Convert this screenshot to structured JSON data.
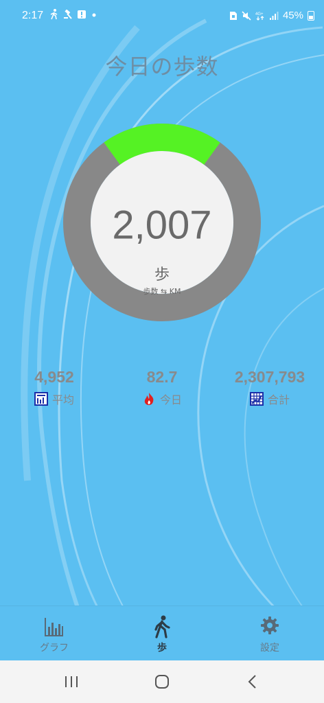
{
  "status": {
    "time": "2:17",
    "battery": "45%",
    "left_icons": [
      "walking-icon",
      "gavel-icon",
      "alert-icon",
      "dot-icon"
    ],
    "right_icons": [
      "sim-icon",
      "mute-icon",
      "data-4g-icon",
      "signal-icon",
      "battery-icon"
    ],
    "network_label": "4G+"
  },
  "page": {
    "title": "今日の歩数"
  },
  "gauge": {
    "value": "2,007",
    "unit": "歩",
    "toggle_label": "歩数 ⇆ KM",
    "progress_fraction": 0.2,
    "progress_color": "#55f224",
    "track_color": "#888888"
  },
  "stats": [
    {
      "value": "4,952",
      "label": "平均",
      "icon": "average-chart-icon"
    },
    {
      "value": "82.7",
      "label": "今日",
      "icon": "flame-icon"
    },
    {
      "value": "2,307,793",
      "label": "合計",
      "icon": "total-grid-icon"
    }
  ],
  "nav": [
    {
      "label": "グラフ",
      "icon": "bar-chart-icon",
      "active": false
    },
    {
      "label": "歩",
      "icon": "walking-icon",
      "active": true
    },
    {
      "label": "設定",
      "icon": "gear-icon",
      "active": false
    }
  ],
  "system_nav": [
    "recents-icon",
    "home-icon",
    "back-icon"
  ],
  "colors": {
    "background": "#5bbff1",
    "accent": "#55f224"
  }
}
